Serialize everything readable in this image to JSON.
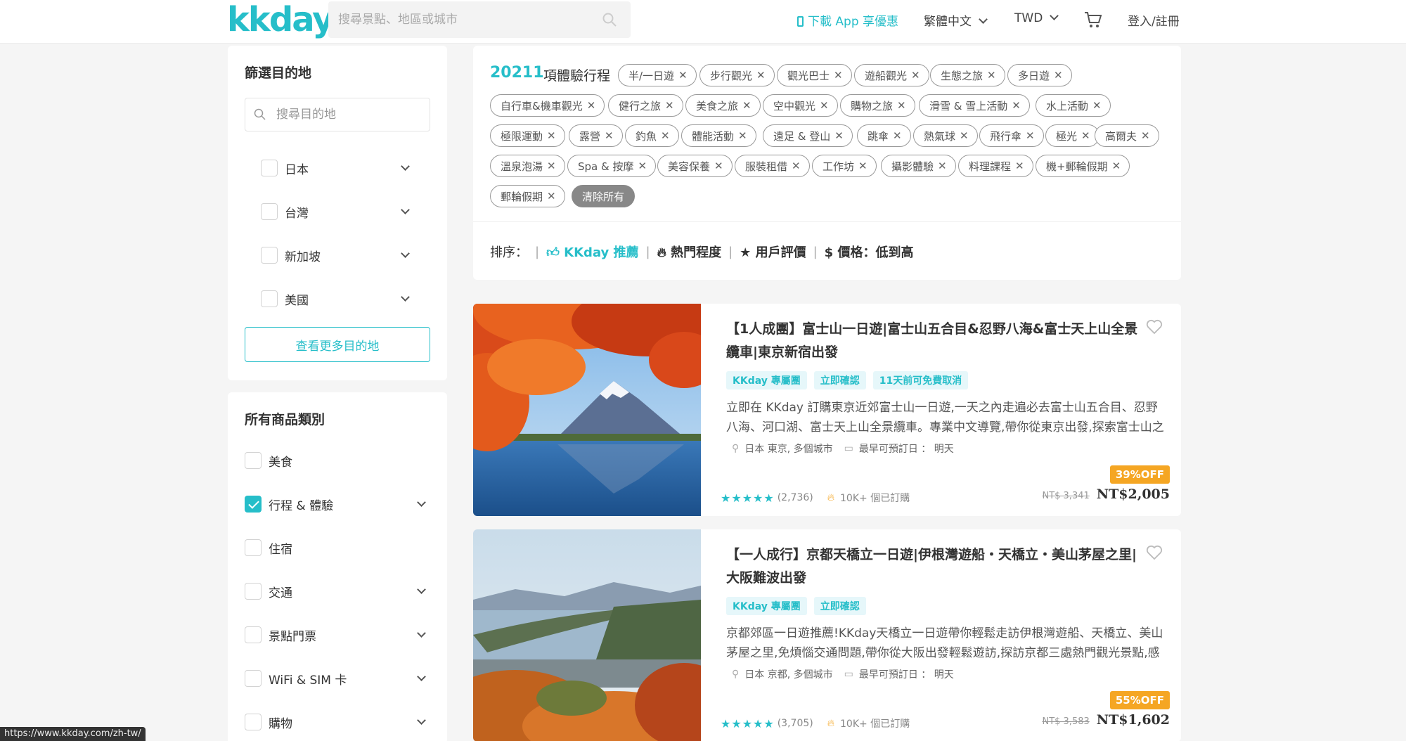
{
  "header": {
    "logo": "kkday",
    "search_placeholder": "搜尋景點、地區或城市",
    "app_label": "下載 App 享優惠",
    "lang_label": "繁體中文",
    "currency_label": "TWD",
    "login_label": "登入/註冊"
  },
  "destination_filter": {
    "title": "篩選目的地",
    "search_placeholder": "搜尋目的地",
    "items": [
      {
        "label": "日本"
      },
      {
        "label": "台灣"
      },
      {
        "label": "新加坡"
      },
      {
        "label": "美國"
      }
    ],
    "more_label": "查看更多目的地"
  },
  "category_filter": {
    "title": "所有商品類別",
    "items": [
      {
        "label": "美食",
        "checked": false,
        "expandable": false
      },
      {
        "label": "行程 & 體驗",
        "checked": true,
        "expandable": true
      },
      {
        "label": "住宿",
        "checked": false,
        "expandable": false
      },
      {
        "label": "交通",
        "checked": false,
        "expandable": true
      },
      {
        "label": "景點門票",
        "checked": false,
        "expandable": true
      },
      {
        "label": "WiFi & SIM 卡",
        "checked": false,
        "expandable": true
      },
      {
        "label": "購物",
        "checked": false,
        "expandable": true
      }
    ]
  },
  "results": {
    "count": "20211",
    "count_label": "項體驗行程",
    "tags": [
      "半/一日遊",
      "步行觀光",
      "觀光巴士",
      "遊船觀光",
      "生態之旅",
      "多日遊",
      "自行車&機車觀光",
      "健行之旅",
      "美食之旅",
      "空中觀光",
      "購物之旅",
      "滑雪 & 雪上活動",
      "水上活動",
      "極限運動",
      "露營",
      "釣魚",
      "體能活動",
      "遠足 & 登山",
      "跳傘",
      "熱氣球",
      "飛行傘",
      "極光",
      "高爾夫",
      "溫泉泡湯",
      "Spa & 按摩",
      "美容保養",
      "服裝租借",
      "工作坊",
      "攝影體驗",
      "料理課程",
      "機+郵輪假期",
      "郵輪假期"
    ],
    "clear_all": "清除所有"
  },
  "sort": {
    "label": "排序：",
    "options": [
      "KKday 推薦",
      "熱門程度",
      "用戶評價",
      "價格：低到高"
    ]
  },
  "products": [
    {
      "title": "【1人成團】富士山一日遊|富士山五合目&忍野八海&富士天上山全景纜車|東京新宿出發",
      "badges": [
        "KKday 專屬團",
        "立即確認",
        "11天前可免費取消"
      ],
      "desc": "立即在 KKday 訂購東京近郊富士山一日遊,一天之內走遍必去富士山五合目、忍野八海、河口湖、富士天上山全景纜車。專業中文導覽,帶你從東京出發,探索富士山之",
      "location": "日本 東京, 多個城市",
      "earliest": "最早可預訂日 ： 明天",
      "reviews": "(2,736)",
      "booked": "10K+ 個已訂購",
      "discount": "39%OFF",
      "old_price": "NT$ 3,341",
      "price": "NT$2,005",
      "rating": 5
    },
    {
      "title": "【一人成行】京都天橋立一日遊|伊根灣遊船・天橋立・美山茅屋之里|大阪難波出發",
      "badges": [
        "KKday 專屬團",
        "立即確認"
      ],
      "desc": "京都郊區一日遊推薦!KKday天橋立一日遊帶你輕鬆走訪伊根灣遊船、天橋立、美山茅屋之里,免煩惱交通問題,帶你從大阪出發輕鬆遊訪,探訪京都三處熱門觀光景點,感",
      "location": "日本 京都, 多個城市",
      "earliest": "最早可預訂日 ： 明天",
      "reviews": "(3,705)",
      "booked": "10K+ 個已訂購",
      "discount": "55%OFF",
      "old_price": "NT$ 3,583",
      "price": "NT$1,602",
      "rating": 5
    }
  ],
  "status_url": "https://www.kkday.com/zh-tw/",
  "colors": {
    "accent": "#26bec9",
    "discount": "#f5a623"
  }
}
